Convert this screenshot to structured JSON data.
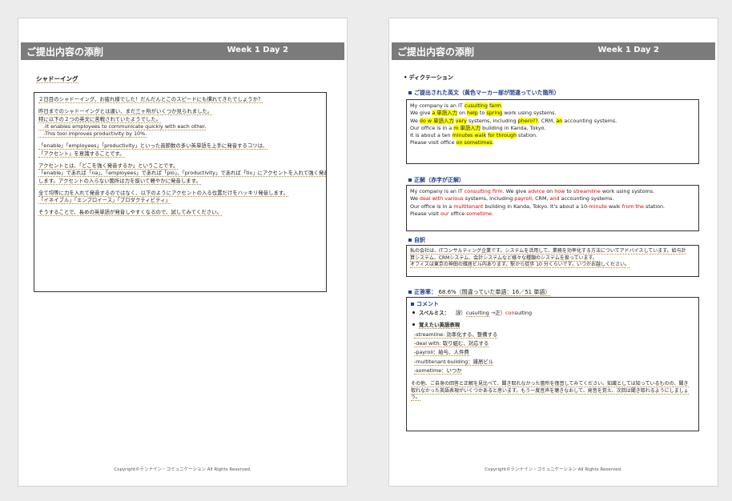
{
  "header": {
    "title": "ご提出内容の添削",
    "week": "Week 1 Day 2"
  },
  "footer": "Copyright©テンナイン・コミュニケーション All Rights Reserved.",
  "left": {
    "section_label": "シャドーイング",
    "lines": [
      "２日目のシャドーイング、お疲れ様でした！だんだんとこのスピードにも慣れてきたでしょうか？",
      "",
      "昨日までのシャドーイングとは違い、まだ三ヶ所がいくつか見られました。",
      "特に以下の２つの英文に苦戦されていたようでした。",
      "　-It enables employees to communicate quickly with each other.",
      "　-This tool improves productivity by 10%.",
      "",
      "「enable」「employees」「productivity」といった音節数の多い英単語を上手に発音するコツは、",
      "「アクセント」を意識することです。",
      "",
      "アクセントとは、「どこを強く発音するか」ということです。",
      "「enable」であれば「na」、「employees」であれば「plo」、「productivity」であれば「tiv」にアクセントを入れて強く発音",
      "します。アクセントの入らない箇所は力を抜いて軽やかに発音します。",
      "",
      "全て均等に力を入れて発音するのではなく、以下のようにアクセントの入る位置だけをハッキリ発音します。",
      "「イネイブル」「エンプロイース」「プロダクティビティ」",
      "",
      "そうすることで、長めの英単語が発音しやすくなるので、試してみてください。"
    ]
  },
  "right": {
    "dictation_label": "ディクテーション",
    "submitted_label": "ご提出された英文（黄色マーカー部が間違っていた箇所）",
    "submitted": [
      [
        "My company is an IT ",
        "!cusulting",
        " ",
        "!farm",
        "."
      ],
      [
        "We give ",
        "!a 単語入力",
        " on ",
        "!help",
        " to ",
        "!spring",
        " work using systems."
      ],
      [
        "We ",
        "!do w 単語入力",
        " ",
        "!very",
        " systems, including ",
        "!phero??",
        ", CRM, ",
        "!an",
        " accounting systems."
      ],
      [
        "Our office is in a ",
        "!m 単語入力",
        " building in Kanda, Tokyo."
      ],
      [
        "It is about a ten ",
        "!minutes walk",
        " ",
        "!for through",
        " station."
      ],
      [
        "Please visit office ",
        "!on sometimes",
        "."
      ]
    ],
    "correct_label": "正解（赤字が正解）",
    "correct": [
      [
        "My company is an IT ",
        "!consulting firm",
        ". We give ",
        "!advice",
        " on ",
        "!how",
        " to ",
        "!streamline",
        " work using systoms."
      ],
      [
        "We ",
        "!deal with various",
        " systems, including ",
        "!payroll",
        ", CRM, ",
        "!and",
        " accounting systems."
      ],
      [
        "Our office is in a ",
        "!multitenant",
        " building in Kanda, Tokyo. It's about a 10-",
        "!minute",
        " walk ",
        "!from the",
        " station."
      ],
      [
        "Please visit ",
        "!our",
        " office ",
        "!sometime",
        "."
      ]
    ],
    "translation_label": "自訳",
    "translation": [
      "私の会社は、ITコンサルティング企業です。システムを活用して、業務を効率化する方法についてアドバイスしています。給与計",
      "算システム、CRMシステム、会計システムなど様々な種類のシステムを扱っています。",
      "オフィスは東京の神田の雑居ビル内あります。駅から徒歩 10 分くらいです。いつかお越しください。"
    ],
    "accuracy_label": "正答率：",
    "accuracy_text": "68.6%（間違っていた単語：16／51 単語）",
    "comment_label": "コメント",
    "spelling_label": "スペルミス：",
    "spelling_wrong_prefix": "誤）",
    "spelling_wrong": "cusulting",
    "spelling_arrow": " →正）",
    "spelling_right_prefix": "con",
    "spelling_right_suffix": "sulting",
    "expressions_label": "覚えたい英語表現",
    "expressions": [
      "-streamline:  効率化する、整備する",
      "-deal with:  取り組む、対応する",
      "-payroll：給与、人件費",
      "-multitenant building：雑居ビル",
      "-sometime：いつか"
    ],
    "closing": [
      "その他、ご自身の回答と正解を見比べて、聞き取れなかった箇所を復習してみてください。知識としては知っているものの、聞き",
      "取れなかった英語表現がいくつかあると思います。もう一度音声を聴きなおして、発音を覚え、次回は聞き取れるようにしましょ",
      "う。"
    ]
  },
  "colors": {
    "header_bg": "#7b7b7b",
    "accent_blue": "#1f3d8f",
    "highlight": "#ffff00",
    "correct_red": "#e00000",
    "underline": "#c77a1a"
  }
}
